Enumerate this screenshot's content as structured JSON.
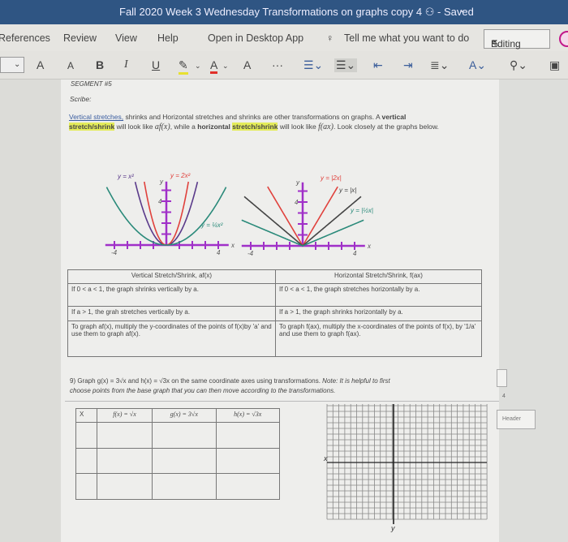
{
  "window": {
    "title": "Fall 2020 Week 3 Wednesday Transformations on graphs copy 4",
    "status": "- Saved",
    "accent": "#2f5583"
  },
  "tabs": {
    "items": [
      "References",
      "Review",
      "View",
      "Help",
      "Open in Desktop App"
    ],
    "tell_me": "Tell me what you want to do",
    "editing": "Editing"
  },
  "toolbar": {
    "grow": "A",
    "shrink": "A",
    "bold": "B",
    "italic": "I",
    "underline": "U",
    "font_color": "A",
    "clear": "A",
    "more": "···"
  },
  "doc": {
    "segment": "SEGMENT #5",
    "scribe": "Scribe:",
    "para": {
      "link": "Vertical stretches,",
      "p1": " shrinks and Horizontal stretches and shrinks are other transformations on graphs. A ",
      "b1": "vertical",
      "hl1": "stretch/shrink",
      "p2": " will look like ",
      "m1": "af(x)",
      "p3": ", while a ",
      "b2": "horizontal",
      "hl2": "stretch/shrink",
      "p4": " will look like ",
      "m2": "f(ax)",
      "p5": ". Look closely at the graphs below."
    },
    "graph1": {
      "labels": [
        "y = x²",
        "y = 2x²",
        "y = ¼x²"
      ],
      "axis": [
        "x",
        "y"
      ],
      "ticks": [
        "-4",
        "4",
        "4"
      ],
      "colors": [
        "#5a3a8a",
        "#e0413c",
        "#2a8a7a"
      ]
    },
    "graph2": {
      "labels": [
        "y = |2x|",
        "y = |x|",
        "y = |½x|"
      ],
      "axis": [
        "x",
        "y"
      ],
      "ticks": [
        "-4",
        "4",
        "4"
      ],
      "colors": [
        "#e0413c",
        "#444444",
        "#2a8a7a"
      ]
    },
    "rules": {
      "headers": [
        "Vertical Stretch/Shrink, af(x)",
        "Horizontal Stretch/Shrink, f(ax)"
      ],
      "rows": [
        [
          "If 0 < a < 1, the graph shrinks vertically by a.",
          "If 0 < a < 1, the graph stretches horizontally by a."
        ],
        [
          "If a > 1, the grah stretches vertically by a.",
          "If a > 1, the graph shrinks horizontally by a."
        ],
        [
          "To graph af(x), multiply the y-coordinates of the points of f(x)by 'a' and use them to graph af(x).",
          "To graph f(ax), multiply the x-coordinates of the points of f(x), by '1/a' and use them to graph f(ax)."
        ]
      ]
    },
    "q9": {
      "line1": "9) Graph g(x) = 3√x and h(x) = √3x on the same coordinate axes using transformations.",
      "note": "Note: It is helpful to first",
      "line2": "choose points from the base graph that you can then move according to the transformations."
    },
    "points_table": {
      "headers": [
        "X",
        "f(x) = √x",
        "g(x) = 3√x",
        "h(x) = √3x"
      ]
    },
    "grid_axes": {
      "x": "x",
      "y": "y"
    }
  },
  "right_margin": {
    "page_num": "4",
    "header": "Header"
  }
}
